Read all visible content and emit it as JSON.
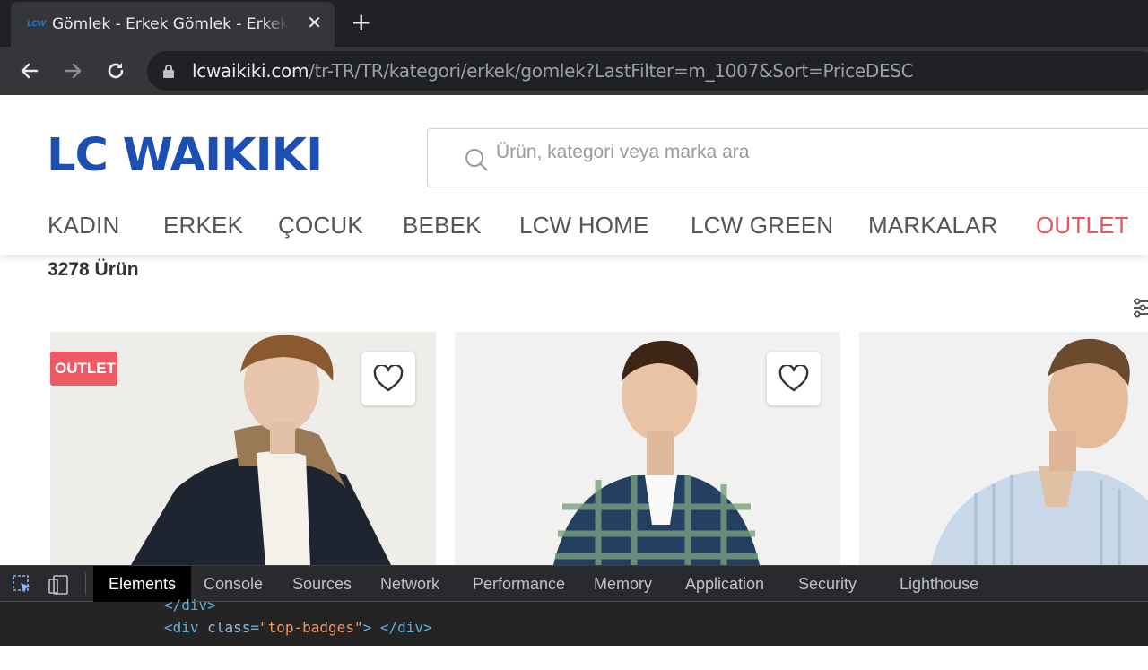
{
  "browser": {
    "tab_favicon": "LCW",
    "tab_title": "Gömlek - Erkek Gömlek - Erkek Gömlek Modelleri",
    "tab_close": "✕",
    "new_tab": "+",
    "url_host": "lcwaikiki.com",
    "url_path": "/tr-TR/TR/kategori/erkek/gomlek?LastFilter=m_1007&Sort=PriceDESC"
  },
  "header": {
    "logo": "LC WAIKIKI",
    "search_placeholder": "Ürün, kategori veya marka ara",
    "nav": [
      "KADIN",
      "ERKEK",
      "ÇOCUK",
      "BEBEK",
      "LCW HOME",
      "LCW GREEN",
      "MARKALAR",
      "OUTLET"
    ]
  },
  "listing": {
    "count": "3278 Ürün",
    "cards": [
      {
        "badge": "OUTLET"
      },
      {},
      {}
    ]
  },
  "devtools": {
    "tabs": [
      "Elements",
      "Console",
      "Sources",
      "Network",
      "Performance",
      "Memory",
      "Application",
      "Security",
      "Lighthouse"
    ],
    "active_tab": "Elements",
    "code_line1": "</div>",
    "code_line2_tag_open": "<div ",
    "code_line2_attr": "class",
    "code_line2_eq": "=",
    "code_line2_val": "\"top-badges\"",
    "code_line2_rest": "> </div>"
  },
  "colors": {
    "brand_blue": "#1d4fb3",
    "outlet_red": "#f0545a",
    "badge_red": "#ee5a64"
  }
}
